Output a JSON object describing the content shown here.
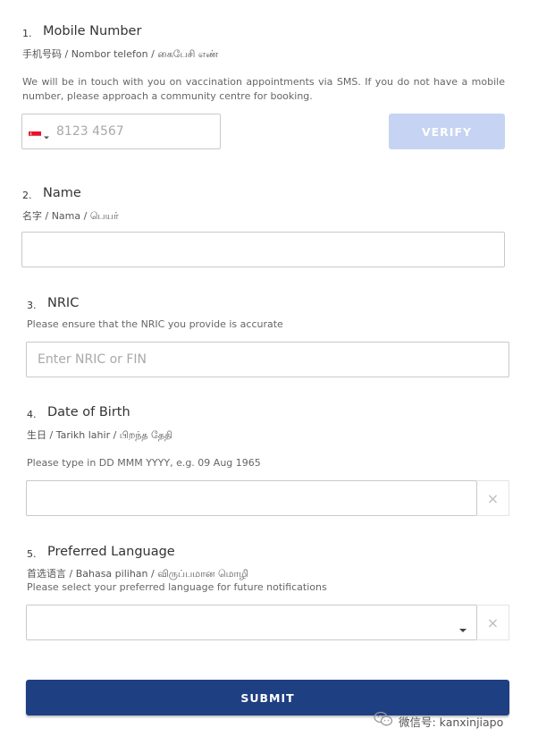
{
  "mobile": {
    "number": "1.",
    "title": "Mobile Number",
    "subtitle": "手机号码 / Nombor telefon / கைபேசி எண்",
    "description": "We will be in touch with you on vaccination appointments via SMS. If you do not have a mobile number, please approach a community centre for booking.",
    "placeholder": "8123 4567",
    "verify_label": "VERIFY",
    "flag_icon": "singapore-flag-icon"
  },
  "name": {
    "number": "2.",
    "title": "Name",
    "subtitle": "名字 / Nama / பெயர்",
    "value": ""
  },
  "nric": {
    "number": "3.",
    "title": "NRIC",
    "description": "Please ensure that the NRIC you provide is accurate",
    "placeholder": "Enter NRIC or FIN"
  },
  "dob": {
    "number": "4.",
    "title": "Date of Birth",
    "subtitle": "生日 / Tarikh lahir / பிறந்த தேதி",
    "description": "Please type in DD MMM YYYY, e.g. 09 Aug 1965",
    "value": "",
    "clear_symbol": "×"
  },
  "language": {
    "number": "5.",
    "title": "Preferred Language",
    "subtitle": "首选语言 / Bahasa pilihan / விருப்பமான மொழி",
    "description": "Please select your preferred language for future notifications",
    "selected": "",
    "clear_symbol": "×"
  },
  "submit_label": "SUBMIT",
  "watermark": {
    "text": "微信号: kanxinjiapo",
    "icon": "wechat-icon"
  },
  "colors": {
    "submit": "#1f3f83",
    "verify_disabled": "#c6d3f2",
    "flag_red": "#e8112d"
  }
}
